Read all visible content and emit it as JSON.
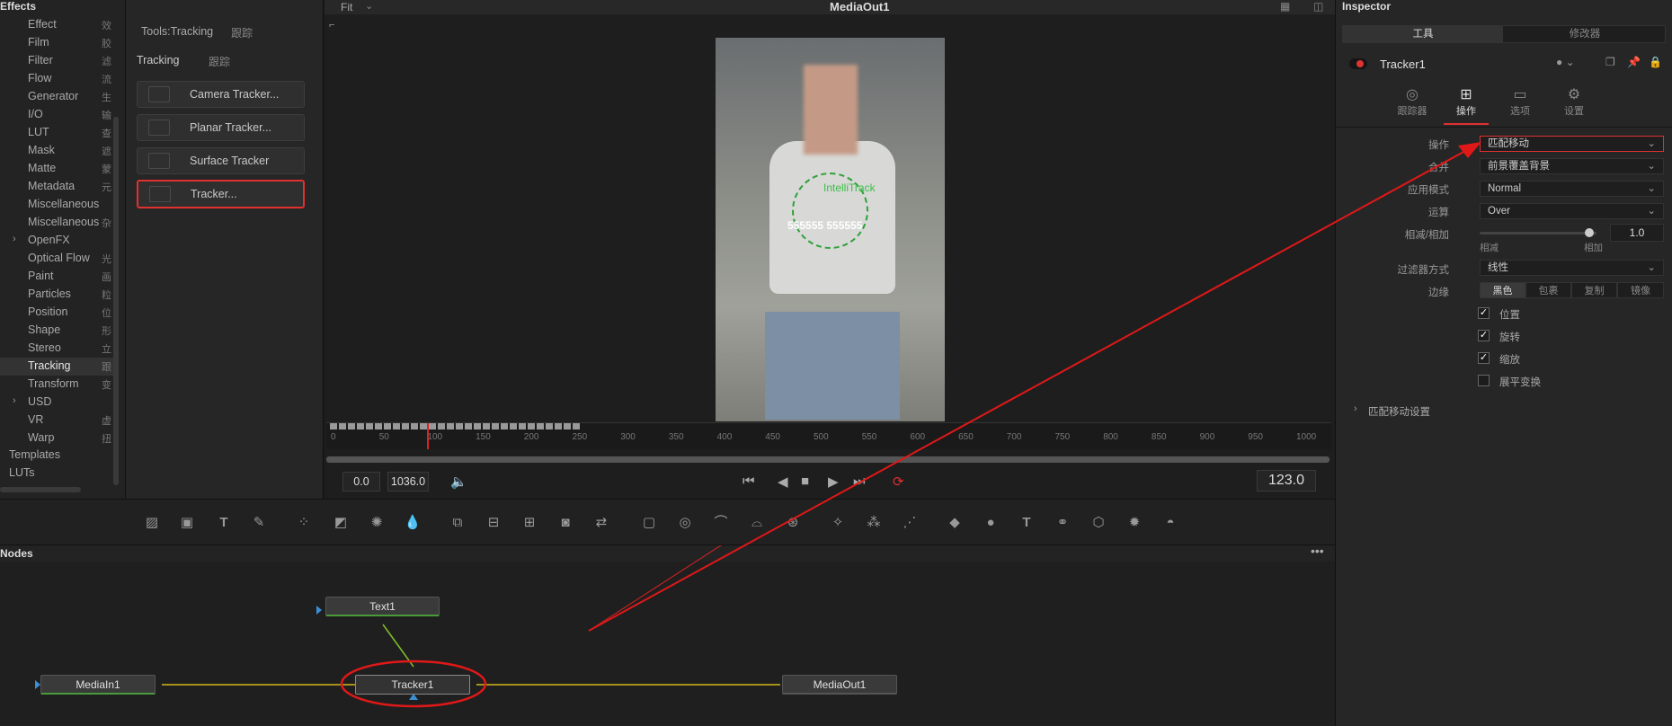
{
  "effects": {
    "title": "Effects",
    "categories": [
      {
        "label": "Effect",
        "zh": "效"
      },
      {
        "label": "Film",
        "zh": "胶"
      },
      {
        "label": "Filter",
        "zh": "滤"
      },
      {
        "label": "Flow",
        "zh": "流"
      },
      {
        "label": "Generator",
        "zh": "生"
      },
      {
        "label": "I/O",
        "zh": "输"
      },
      {
        "label": "LUT",
        "zh": "查"
      },
      {
        "label": "Mask",
        "zh": "遮"
      },
      {
        "label": "Matte",
        "zh": "蒙"
      },
      {
        "label": "Metadata",
        "zh": "元"
      },
      {
        "label": "Miscellaneous",
        "zh": ""
      },
      {
        "label": "Miscellaneous",
        "zh": "杂"
      },
      {
        "label": "OpenFX",
        "zh": ""
      },
      {
        "label": "Optical Flow",
        "zh": "光"
      },
      {
        "label": "Paint",
        "zh": "画"
      },
      {
        "label": "Particles",
        "zh": "粒"
      },
      {
        "label": "Position",
        "zh": "位"
      },
      {
        "label": "Shape",
        "zh": "形"
      },
      {
        "label": "Stereo",
        "zh": "立"
      },
      {
        "label": "Tracking",
        "zh": "跟"
      },
      {
        "label": "Transform",
        "zh": "变"
      },
      {
        "label": "USD",
        "zh": ""
      },
      {
        "label": "VR",
        "zh": "虚"
      },
      {
        "label": "Warp",
        "zh": "扭"
      }
    ],
    "templates": "Templates",
    "luts": "LUTs"
  },
  "tools": {
    "breadcrumb": "Tools:Tracking",
    "breadcrumb_zh": "跟踪",
    "section": "Tracking",
    "section_zh": "跟踪",
    "buttons": [
      "Camera Tracker...",
      "Planar Tracker...",
      "Surface Tracker",
      "Tracker..."
    ]
  },
  "viewer": {
    "fit": "Fit",
    "title": "MediaOut1",
    "overlay_text": "IntelliTrack",
    "overlay_numbers": "555555 555555",
    "ticks": [
      "0",
      "50",
      "100",
      "150",
      "200",
      "250",
      "300",
      "350",
      "400",
      "450",
      "500",
      "550",
      "600",
      "650",
      "700",
      "750",
      "800",
      "850",
      "900",
      "950",
      "1000"
    ],
    "start": "0.0",
    "end": "1036.0",
    "current": "123.0"
  },
  "nodes": {
    "title": "Nodes",
    "items": [
      "Text1",
      "MediaIn1",
      "Tracker1",
      "MediaOut1"
    ]
  },
  "inspector": {
    "title": "Inspector",
    "tab_tools": "工具",
    "tab_modifiers": "修改器",
    "node_name": "Tracker1",
    "subtabs": [
      "跟踪器",
      "操作",
      "选项",
      "设置"
    ],
    "operation_label": "操作",
    "operation_value": "匹配移动",
    "merge_label": "合并",
    "merge_value": "前景覆盖背景",
    "apply_mode_label": "应用模式",
    "apply_mode_value": "Normal",
    "operator_label": "运算",
    "operator_value": "Over",
    "subtract_add_label": "相减/相加",
    "subtract_add_value": "1.0",
    "subtract_label": "相减",
    "add_label": "相加",
    "slider_fraction": 0.94,
    "filter_label": "过滤器方式",
    "filter_value": "线性",
    "edges_label": "边缘",
    "edges": [
      "黑色",
      "包裹",
      "复制",
      "镜像"
    ],
    "checks": [
      {
        "label": "位置",
        "checked": true
      },
      {
        "label": "旋转",
        "checked": true
      },
      {
        "label": "缩放",
        "checked": true
      },
      {
        "label": "展平变换",
        "checked": false
      }
    ],
    "match_settings": "匹配移动设置"
  }
}
